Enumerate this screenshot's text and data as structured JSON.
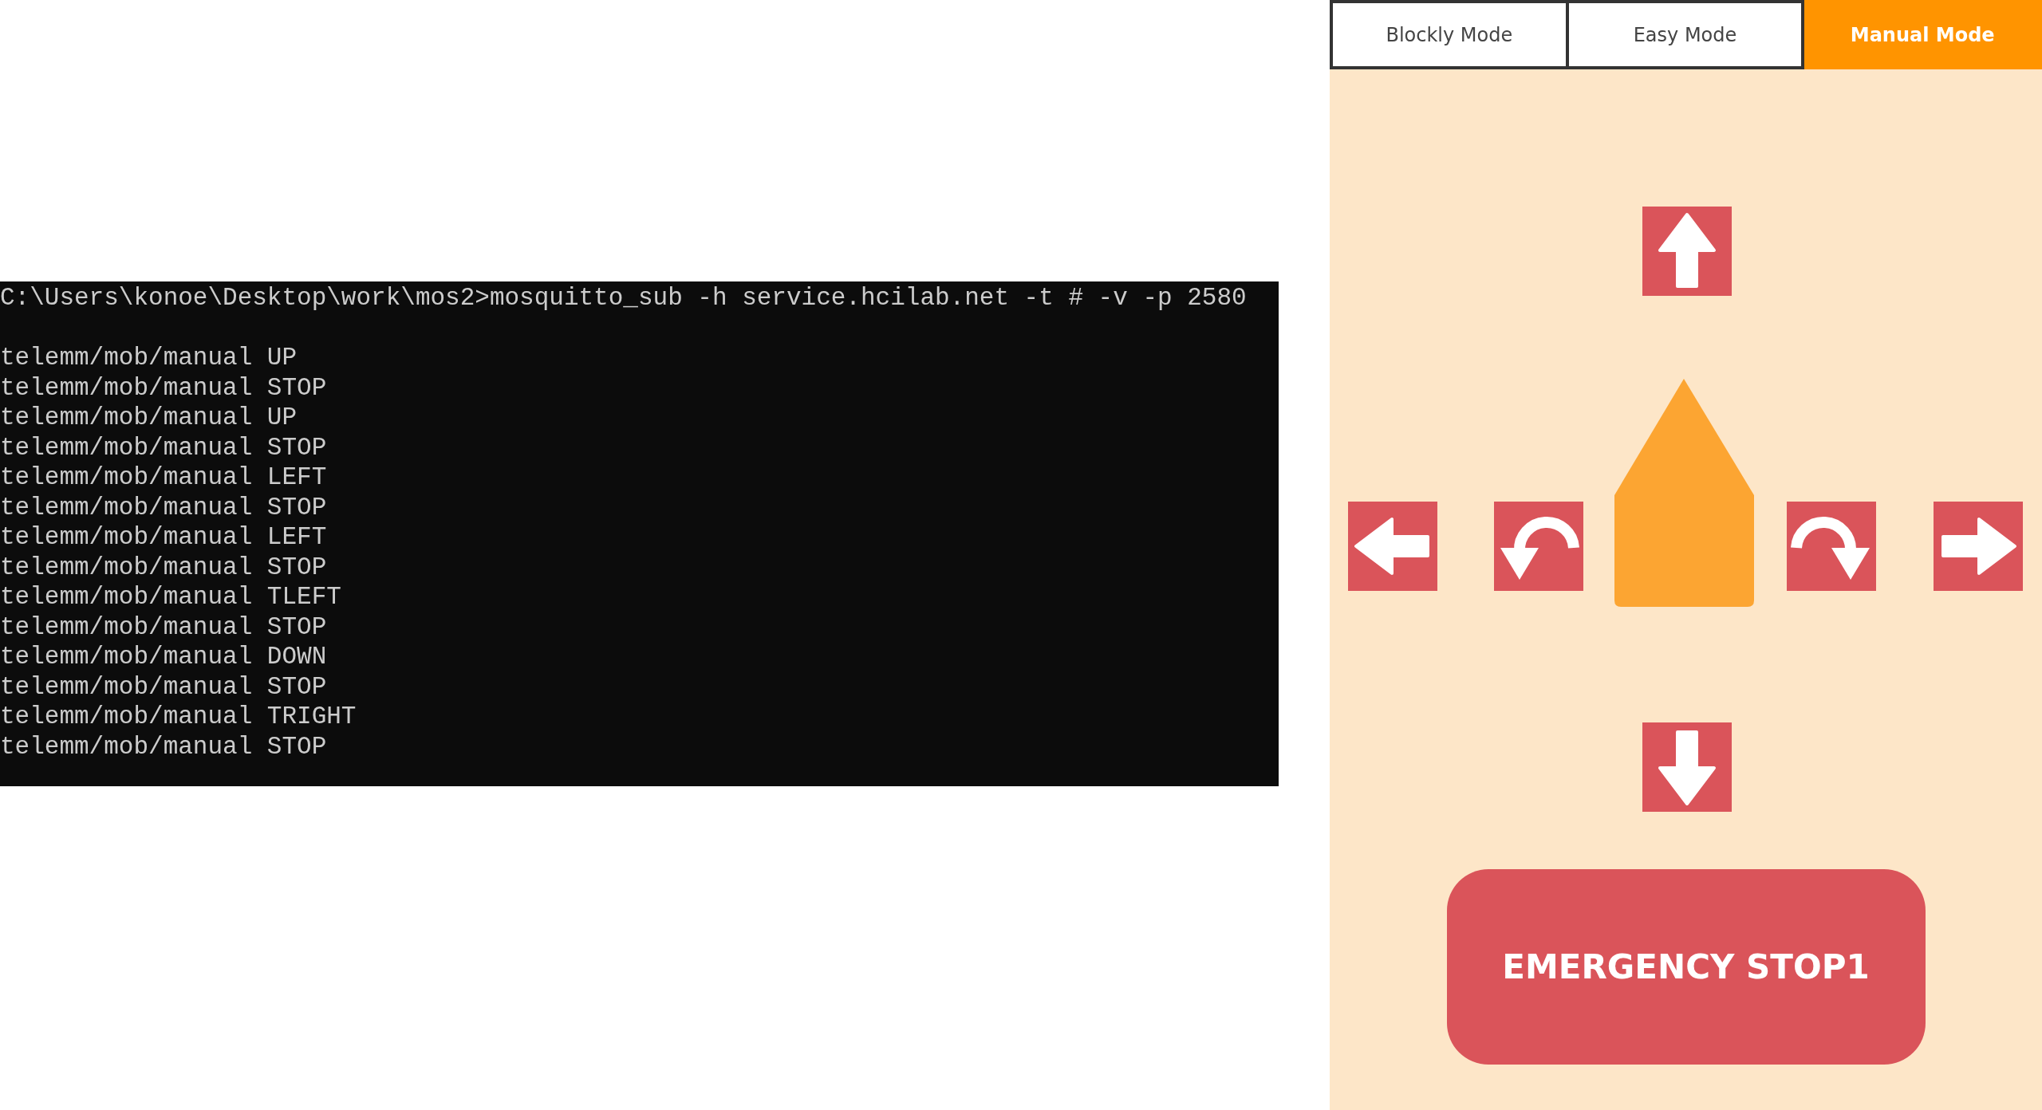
{
  "terminal": {
    "command": "C:\\Users\\konoe\\Desktop\\work\\mos2>mosquitto_sub -h service.hcilab.net -t # -v -p 2580",
    "lines": [
      "telemm/mob/manual UP",
      "telemm/mob/manual STOP",
      "telemm/mob/manual UP",
      "telemm/mob/manual STOP",
      "telemm/mob/manual LEFT",
      "telemm/mob/manual STOP",
      "telemm/mob/manual LEFT",
      "telemm/mob/manual STOP",
      "telemm/mob/manual TLEFT",
      "telemm/mob/manual STOP",
      "telemm/mob/manual DOWN",
      "telemm/mob/manual STOP",
      "telemm/mob/manual TRIGHT",
      "telemm/mob/manual STOP"
    ]
  },
  "tabs": [
    {
      "label": "Blockly Mode",
      "selected": false
    },
    {
      "label": "Easy Mode",
      "selected": false
    },
    {
      "label": "Manual Mode",
      "selected": true
    }
  ],
  "emergency_button": {
    "label": "EMERGENCY STOP1"
  }
}
